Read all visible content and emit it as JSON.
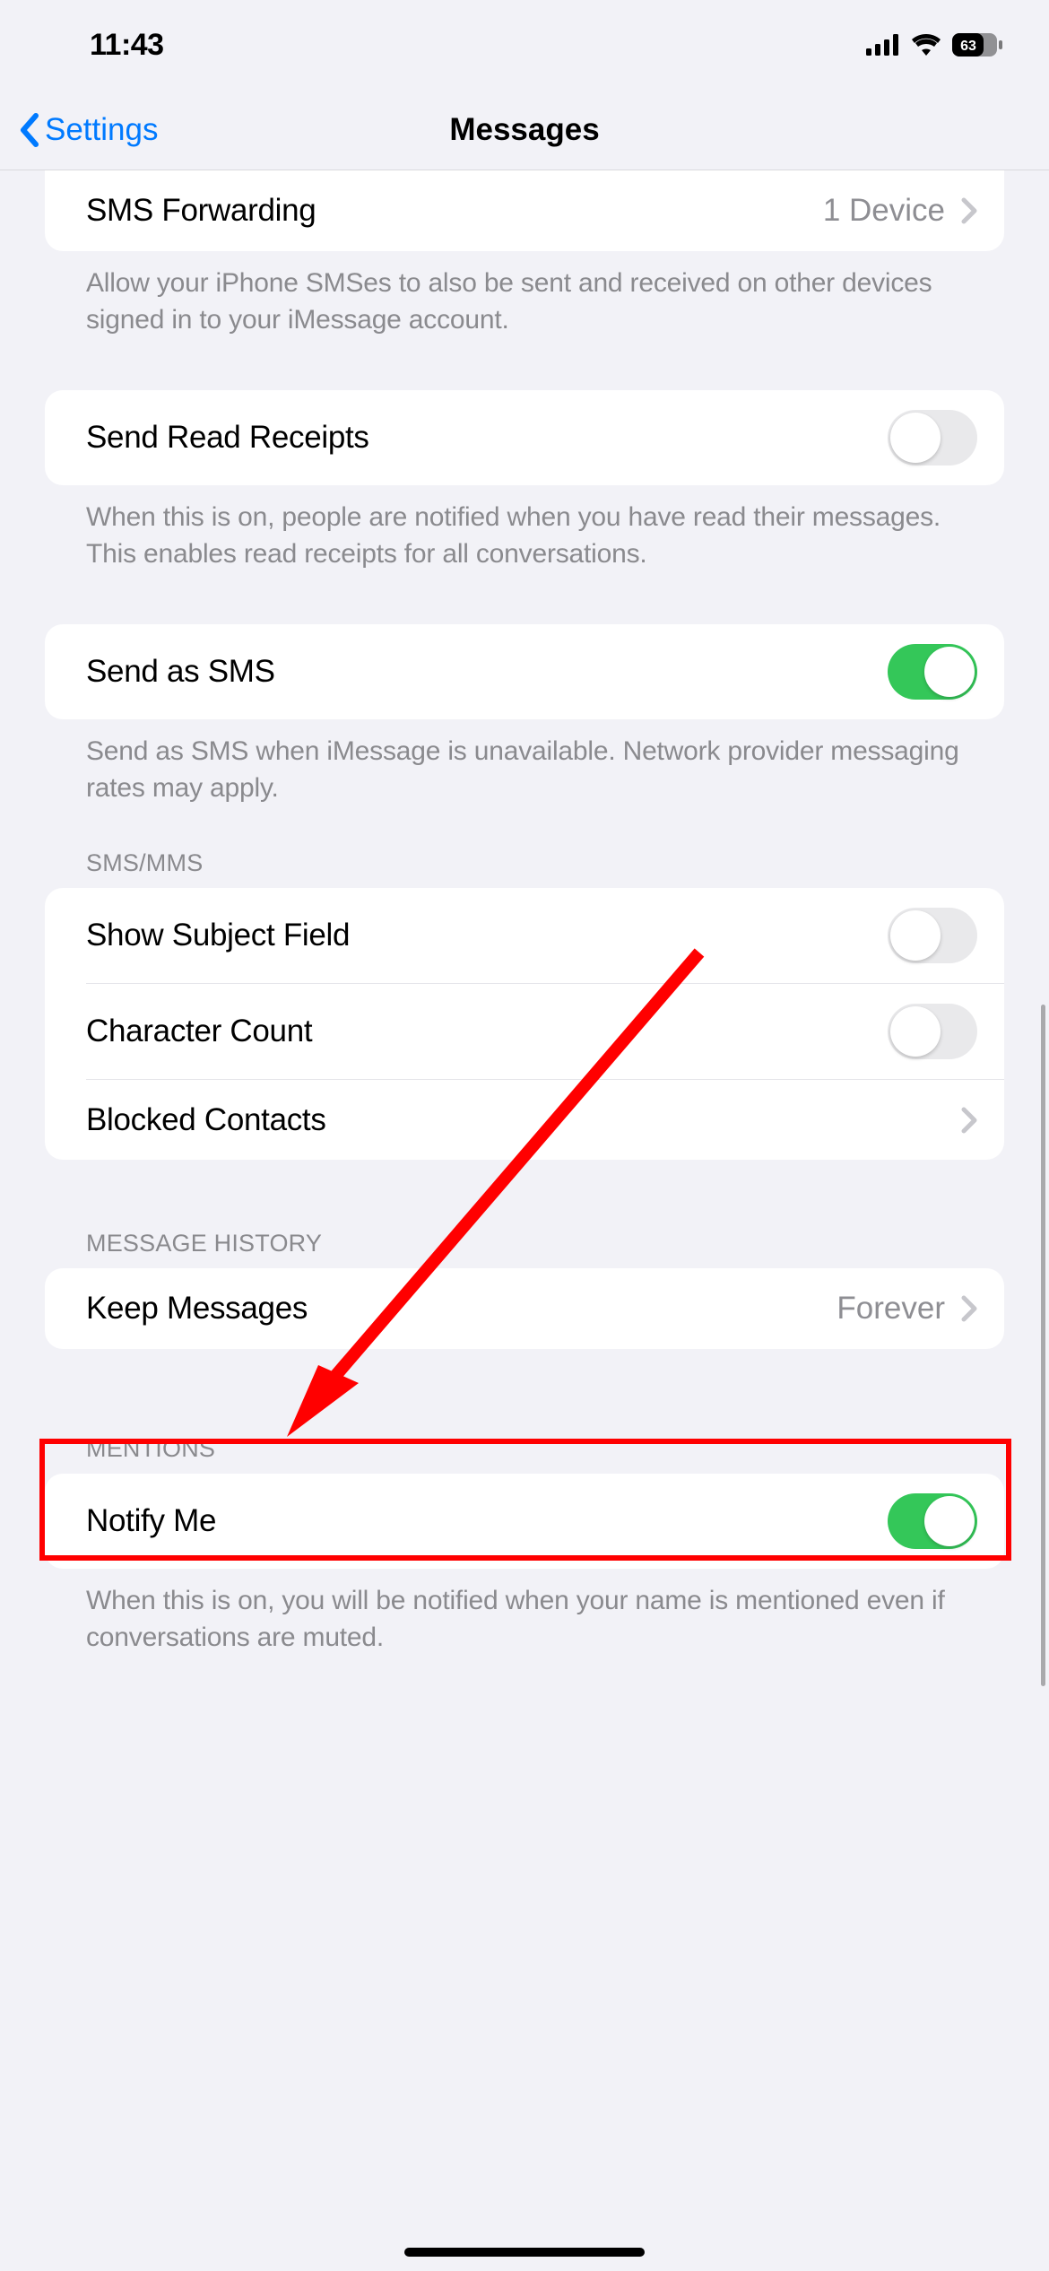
{
  "status": {
    "time": "11:43",
    "battery": "63"
  },
  "nav": {
    "back": "Settings",
    "title": "Messages"
  },
  "rows": {
    "sms_forwarding": {
      "label": "SMS Forwarding",
      "value": "1 Device"
    },
    "sms_forwarding_footer": "Allow your iPhone SMSes to also be sent and received on other devices signed in to your iMessage account.",
    "read_receipts": {
      "label": "Send Read Receipts"
    },
    "read_receipts_footer": "When this is on, people are notified when you have read their messages. This enables read receipts for all conversations.",
    "send_as_sms": {
      "label": "Send as SMS"
    },
    "send_as_sms_footer": "Send as SMS when iMessage is unavailable. Network provider messaging rates may apply.",
    "sms_mms_header": "SMS/MMS",
    "show_subject": {
      "label": "Show Subject Field"
    },
    "character_count": {
      "label": "Character Count"
    },
    "blocked_contacts": {
      "label": "Blocked Contacts"
    },
    "message_history_header": "MESSAGE HISTORY",
    "keep_messages": {
      "label": "Keep Messages",
      "value": "Forever"
    },
    "mentions_header": "MENTIONS",
    "notify_me": {
      "label": "Notify Me"
    },
    "notify_me_footer": "When this is on, you will be notified when your name is mentioned even if conversations are muted."
  }
}
